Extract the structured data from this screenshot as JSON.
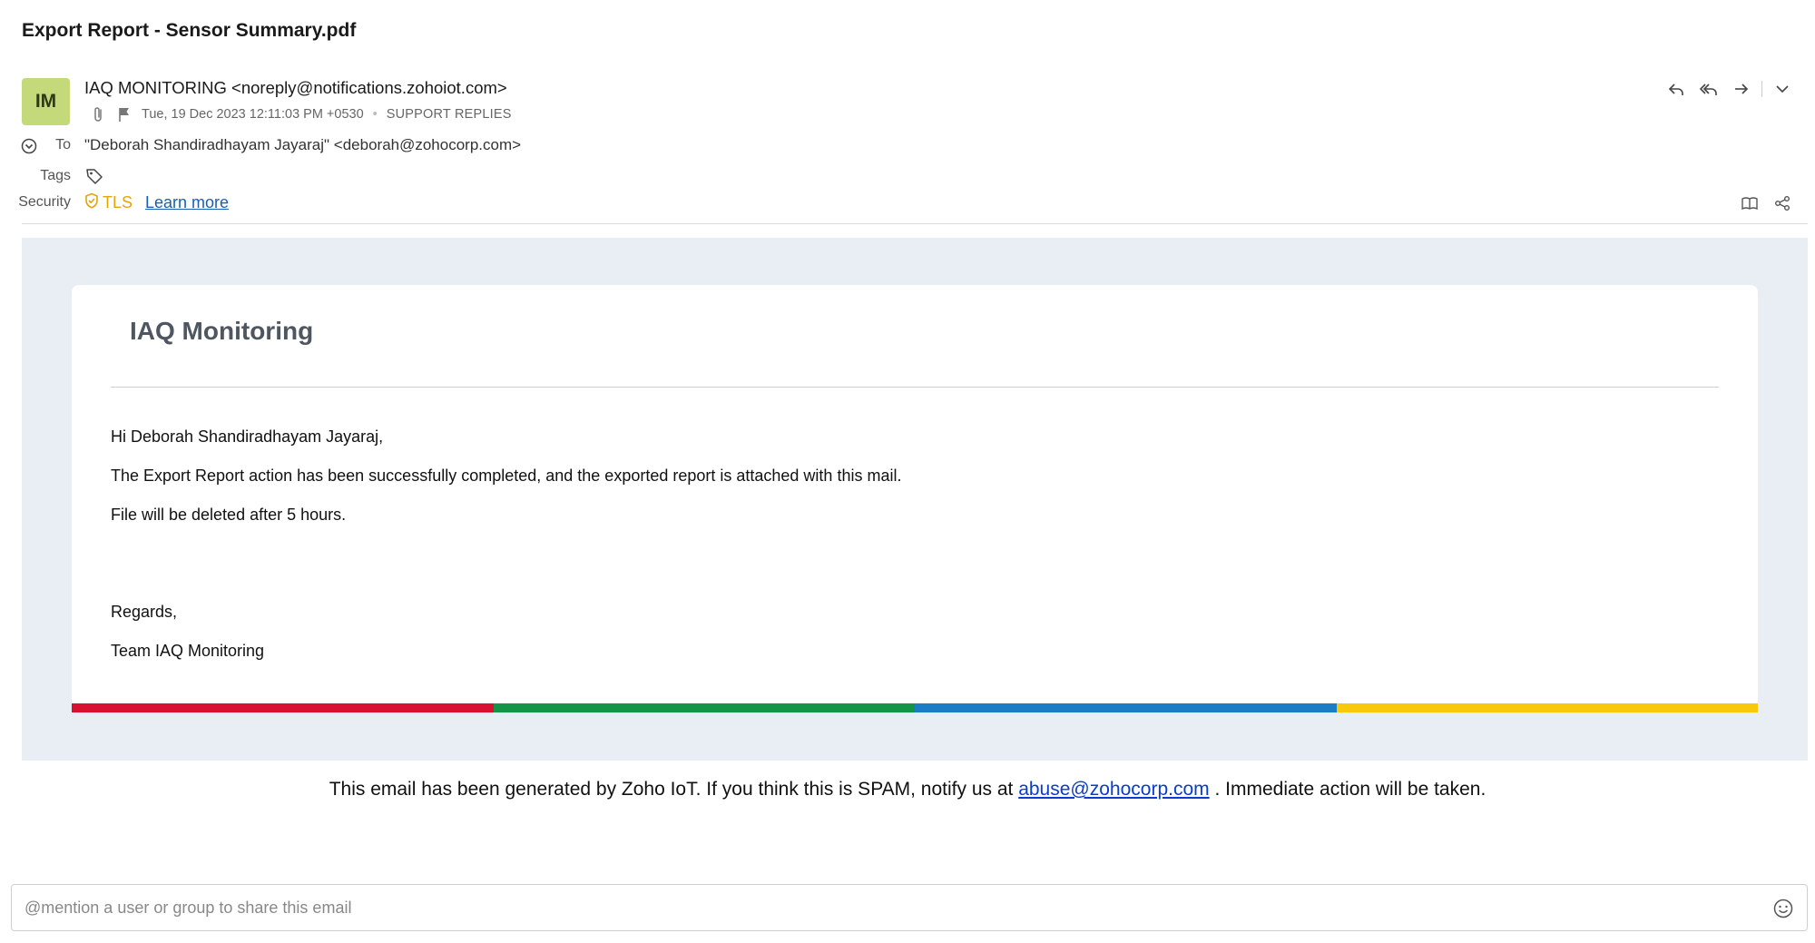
{
  "email": {
    "subject": "Export Report - Sensor Summary.pdf",
    "avatar_initials": "IM",
    "avatar_color": "#c3d97a",
    "sender": "IAQ MONITORING <noreply@notifications.zohoiot.com>",
    "date": "Tue, 19 Dec 2023 12:11:03 PM +0530",
    "folder": "SUPPORT REPLIES",
    "to_label": "To",
    "to_value_visible": "\"Deborah Shandiradhayam Jayaraj\" <deborah@zohocorp.com>",
    "tags_label": "Tags",
    "security_label": "Security",
    "security_value": "TLS",
    "learn_more": "Learn more"
  },
  "card": {
    "title": "IAQ Monitoring",
    "greeting": "Hi Deborah Shandiradhayam Jayaraj,",
    "line1": "The Export Report action has been successfully completed, and the exported report is attached with this mail.",
    "line2": "File will be deleted after 5 hours.",
    "regards": "Regards,",
    "team": "Team IAQ Monitoring",
    "bar_colors": [
      "#d8122e",
      "#149447",
      "#1a7dc6",
      "#f8c80a"
    ]
  },
  "footer": {
    "text_before": "This email has been generated by Zoho IoT. If you think this is SPAM, notify us at ",
    "link": "abuse@zohocorp.com",
    "text_after": " . Immediate action will be taken."
  },
  "mention": {
    "placeholder": "@mention a user or group to share this email"
  },
  "icons": {
    "attachment": "paperclip-icon",
    "flag": "flag-icon",
    "reply": "reply-icon",
    "reply_all": "reply-all-icon",
    "forward": "forward-icon",
    "more": "chevron-down-icon",
    "tag": "tag-icon",
    "shield": "shield-icon",
    "reader": "book-icon",
    "share": "share-icon",
    "emoji": "emoji-icon"
  }
}
